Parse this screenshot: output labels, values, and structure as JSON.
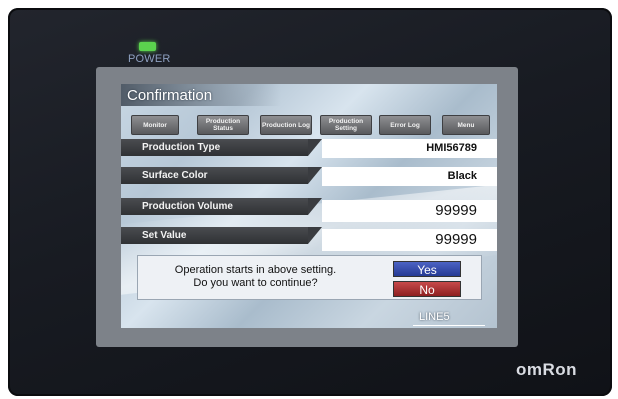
{
  "device": {
    "power_label": "POWER",
    "brand": "omRon"
  },
  "screen": {
    "title": "Confirmation",
    "nav": [
      {
        "label": "Monitor"
      },
      {
        "label": "Production Status"
      },
      {
        "label": "Production Log"
      },
      {
        "label": "Production Setting"
      },
      {
        "label": "Error Log"
      },
      {
        "label": "Menu"
      }
    ],
    "rows": [
      {
        "label": "Production Type",
        "value": "HMI56789"
      },
      {
        "label": "Surface Color",
        "value": "Black"
      },
      {
        "label": "Production Volume",
        "value": "99999"
      },
      {
        "label": "Set Value",
        "value": "99999"
      }
    ],
    "dialog": {
      "line1": "Operation starts in above setting.",
      "line2": "Do you want to continue?",
      "yes_label": "Yes",
      "no_label": "No"
    },
    "line_label": "LINE5"
  },
  "colors": {
    "power_led": "#5bd24e",
    "yes_button": "#3a52b3",
    "no_button": "#b03536"
  }
}
